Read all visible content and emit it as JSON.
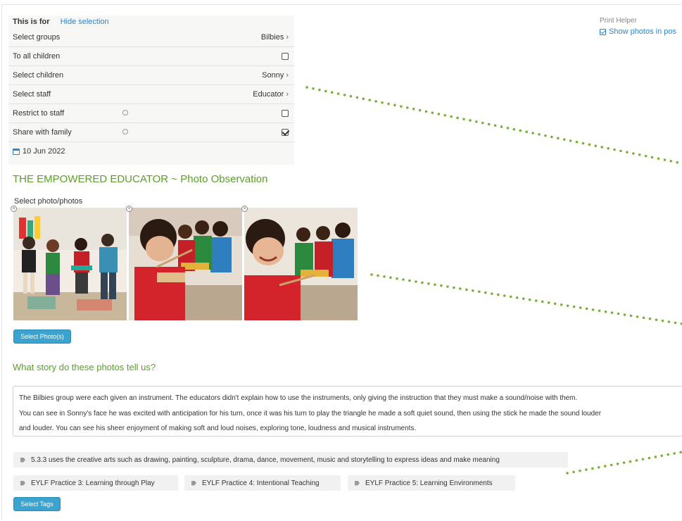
{
  "selection": {
    "label": "This is for",
    "hide_link": "Hide selection",
    "rows": [
      {
        "label": "Select groups",
        "value": "Bilbies"
      },
      {
        "label": "To all children"
      },
      {
        "label": "Select children",
        "value": "Sonny"
      },
      {
        "label": "Select staff",
        "value": "Educator"
      },
      {
        "label": "Restrict to staff"
      },
      {
        "label": "Share with family"
      }
    ],
    "date": "10 Jun 2022"
  },
  "print_helper": {
    "title": "Print Helper",
    "show_photos": "Show photos in pos"
  },
  "observation": {
    "title": "THE EMPOWERED EDUCATOR ~ Photo Observation",
    "select_photo_label": "Select photo/photos",
    "select_photos_button": "Select Photo(s)",
    "question": "What story do these photos tell us?",
    "story_lines": [
      "The Bilbies group were each given an instrument. The educators didn't explain how to use the instruments, only giving the instruction that they must make a sound/noise with them.",
      "You can see in Sonny's face he was excited with anticipation for his turn, once it was his turn to play the triangle he made a soft quiet sound, then using the stick he made the sound louder",
      "and louder. You can see his sheer enjoyment of making soft and loud noises, exploring tone, loudness and musical instruments."
    ],
    "tags": [
      "5.3.3 uses the creative arts such as drawing, painting, sculpture, drama, dance, movement, music and storytelling to express ideas and make meaning",
      "EYLF Practice 3: Learning through Play",
      "EYLF Practice 4: Intentional Teaching",
      "EYLF Practice 5: Learning Environments"
    ],
    "select_tags_button": "Select Tags"
  },
  "icons": {
    "remove_photo": "close-circle-icon",
    "help": "question-circle-icon",
    "calendar": "calendar-icon",
    "tag": "tag-icon",
    "chevron": "chevron-right-icon"
  },
  "colors": {
    "accent_green": "#5aa028",
    "link_blue": "#2e86c8",
    "button_blue": "#3aa3cf",
    "dotted_arrow": "#7ab03a"
  }
}
